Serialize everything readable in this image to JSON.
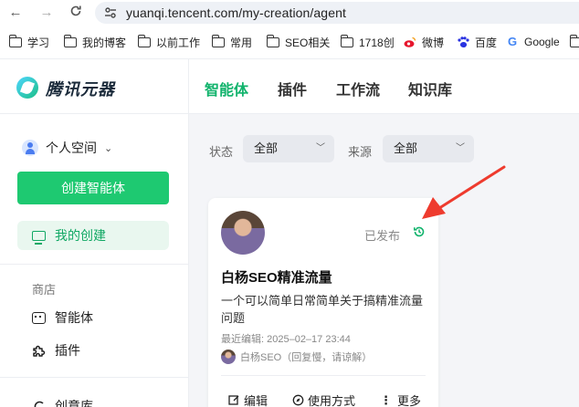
{
  "browser": {
    "url": "yuanqi.tencent.com/my-creation/agent",
    "bookmarks": [
      {
        "label": "学习",
        "type": "folder"
      },
      {
        "label": "我的博客",
        "type": "folder"
      },
      {
        "label": "以前工作",
        "type": "folder"
      },
      {
        "label": "常用",
        "type": "folder"
      },
      {
        "label": "SEO相关",
        "type": "folder"
      },
      {
        "label": "1718创",
        "type": "folder"
      },
      {
        "label": "微博",
        "type": "weibo"
      },
      {
        "label": "百度",
        "type": "baidu"
      },
      {
        "label": "Google",
        "type": "google"
      }
    ]
  },
  "app": {
    "logo_text": "腾讯元器",
    "tabs": [
      {
        "label": "智能体",
        "active": true
      },
      {
        "label": "插件",
        "active": false
      },
      {
        "label": "工作流",
        "active": false
      },
      {
        "label": "知识库",
        "active": false
      }
    ],
    "accent_color": "#11b36c"
  },
  "sidebar": {
    "space_label": "个人空间",
    "create_button": "创建智能体",
    "my_creation": "我的创建",
    "section_store": "商店",
    "items": [
      {
        "label": "智能体",
        "icon": "robot-icon"
      },
      {
        "label": "插件",
        "icon": "puzzle-icon"
      },
      {
        "label": "创意库",
        "icon": "library-icon"
      }
    ]
  },
  "filters": {
    "status_label": "状态",
    "status_value": "全部",
    "source_label": "来源",
    "source_value": "全部"
  },
  "card": {
    "status": "已发布",
    "title": "白杨SEO精准流量",
    "description": "一个可以简单日常简单关于搞精准流量问题",
    "last_edit": "最近编辑: 2025–02–17 23:44",
    "author": "白杨SEO（回复慢，请谅解）",
    "actions": {
      "edit": "编辑",
      "usage": "使用方式",
      "more": "更多"
    }
  }
}
